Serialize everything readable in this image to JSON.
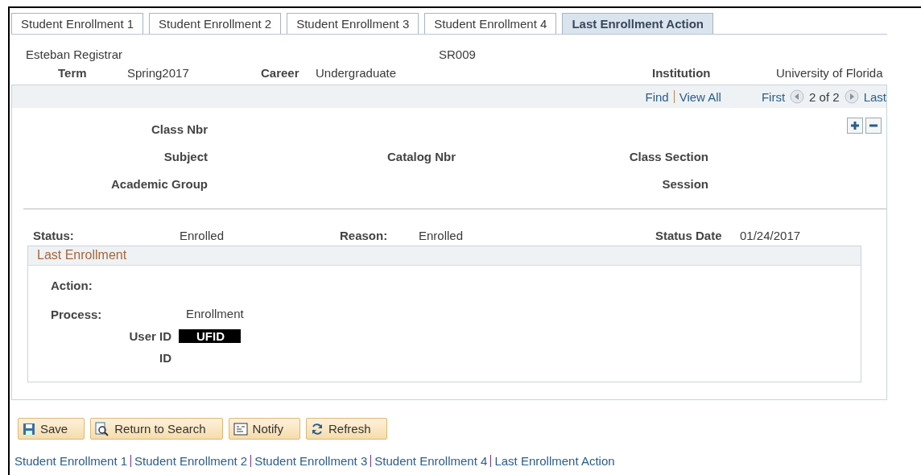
{
  "tabs": [
    {
      "label": "Student Enrollment 1",
      "selected": false
    },
    {
      "label": "Student Enrollment 2",
      "selected": false
    },
    {
      "label": "Student Enrollment 3",
      "selected": false
    },
    {
      "label": "Student Enrollment 4",
      "selected": false
    },
    {
      "label": "Last Enrollment Action",
      "selected": true
    }
  ],
  "header": {
    "name": "Esteban Registrar",
    "id": "SR009",
    "term_label": "Term",
    "term": "Spring2017",
    "career_label": "Career",
    "career": "Undergraduate",
    "institution_label": "Institution",
    "institution": "University of Florida"
  },
  "scroll_area": {
    "find": "Find",
    "view_all": "View All",
    "first": "First",
    "position": "2 of 2",
    "last": "Last",
    "first_enabled": false,
    "last_enabled": false,
    "class_nbr_label": "Class Nbr",
    "subject_label": "Subject",
    "catalog_label": "Catalog Nbr",
    "section_label": "Class Section",
    "group_label": "Academic Group",
    "session_label": "Session",
    "status_label": "Status:",
    "status": "Enrolled",
    "reason_label": "Reason:",
    "reason": "Enrolled",
    "date_label": "Status Date",
    "date": "01/24/2017",
    "last_enrollment": {
      "title": "Last Enrollment",
      "action_label": "Action:",
      "process_label": "Process:",
      "process": "Enrollment",
      "user_label": "User ID",
      "user": "UFID",
      "id_label": "ID"
    }
  },
  "buttons": [
    {
      "kind": "save",
      "label": "Save"
    },
    {
      "kind": "search",
      "label": "Return to Search"
    },
    {
      "kind": "notify",
      "label": "Notify"
    },
    {
      "kind": "refresh",
      "label": "Refresh"
    }
  ],
  "links": [
    "Student Enrollment 1",
    "Student Enrollment 2",
    "Student Enrollment 3",
    "Student Enrollment 4",
    "Last Enrollment Action"
  ]
}
